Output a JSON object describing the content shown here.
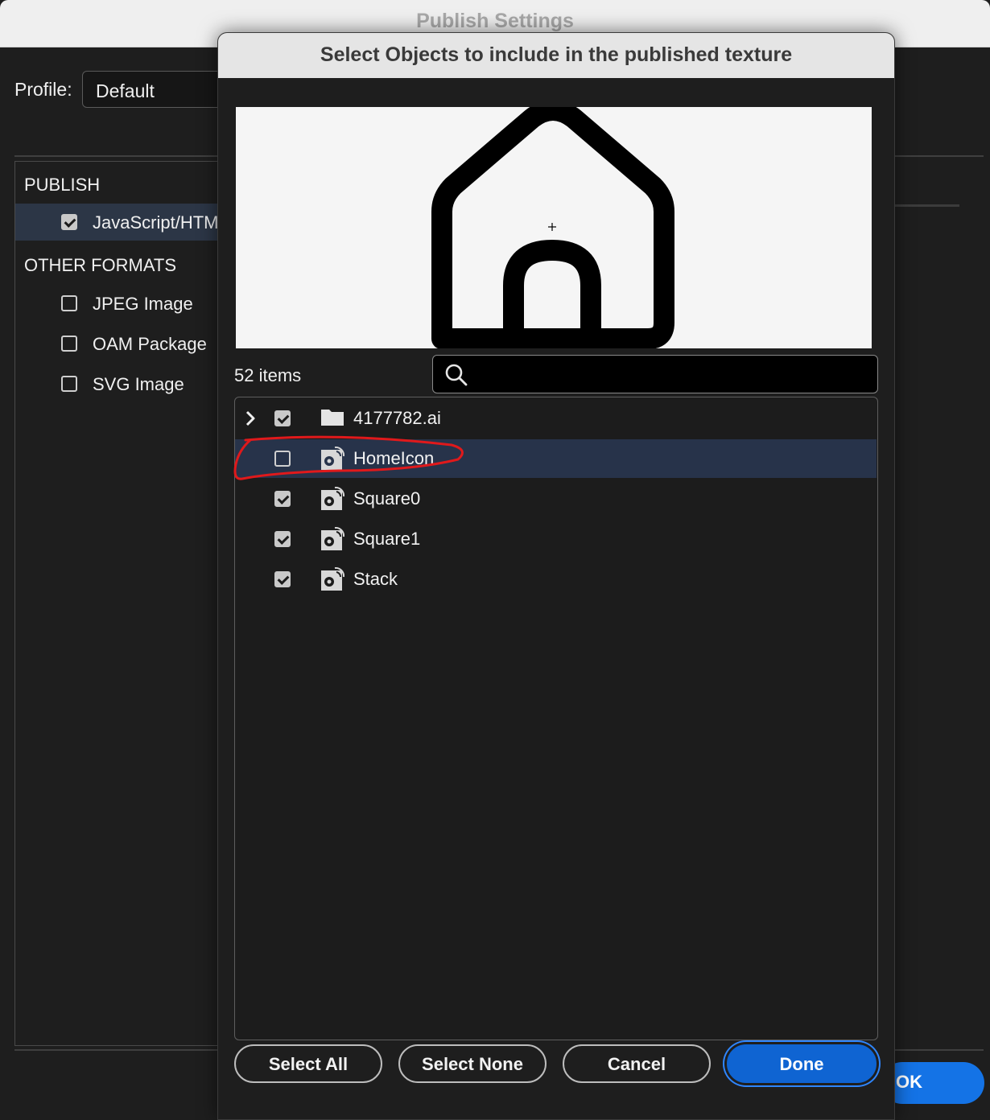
{
  "window": {
    "title": "Publish Settings"
  },
  "profile": {
    "label": "Profile:",
    "value": "Default"
  },
  "left_panel": {
    "publish_header": "PUBLISH",
    "publish_items": [
      {
        "label": "JavaScript/HTML",
        "checked": true
      }
    ],
    "other_header": "OTHER FORMATS",
    "other_items": [
      {
        "label": "JPEG Image",
        "checked": false
      },
      {
        "label": "OAM Package",
        "checked": false
      },
      {
        "label": "SVG Image",
        "checked": false
      }
    ]
  },
  "ok_button": "OK",
  "dialog": {
    "title": "Select Objects to include in the published texture",
    "item_count": "52 items",
    "search": {
      "value": "",
      "placeholder": ""
    },
    "tree": [
      {
        "label": "4177782.ai",
        "checked": true,
        "type": "folder",
        "expandable": true,
        "selected": false
      },
      {
        "label": "HomeIcon",
        "checked": false,
        "type": "symbol",
        "expandable": false,
        "selected": true
      },
      {
        "label": "Square0",
        "checked": true,
        "type": "symbol",
        "expandable": false,
        "selected": false
      },
      {
        "label": "Square1",
        "checked": true,
        "type": "symbol",
        "expandable": false,
        "selected": false
      },
      {
        "label": "Stack",
        "checked": true,
        "type": "symbol",
        "expandable": false,
        "selected": false
      }
    ],
    "buttons": {
      "select_all": "Select All",
      "select_none": "Select None",
      "cancel": "Cancel",
      "done": "Done"
    }
  },
  "colors": {
    "accent": "#1473e6",
    "selection": "#27334a",
    "annotation": "#e0191b"
  }
}
